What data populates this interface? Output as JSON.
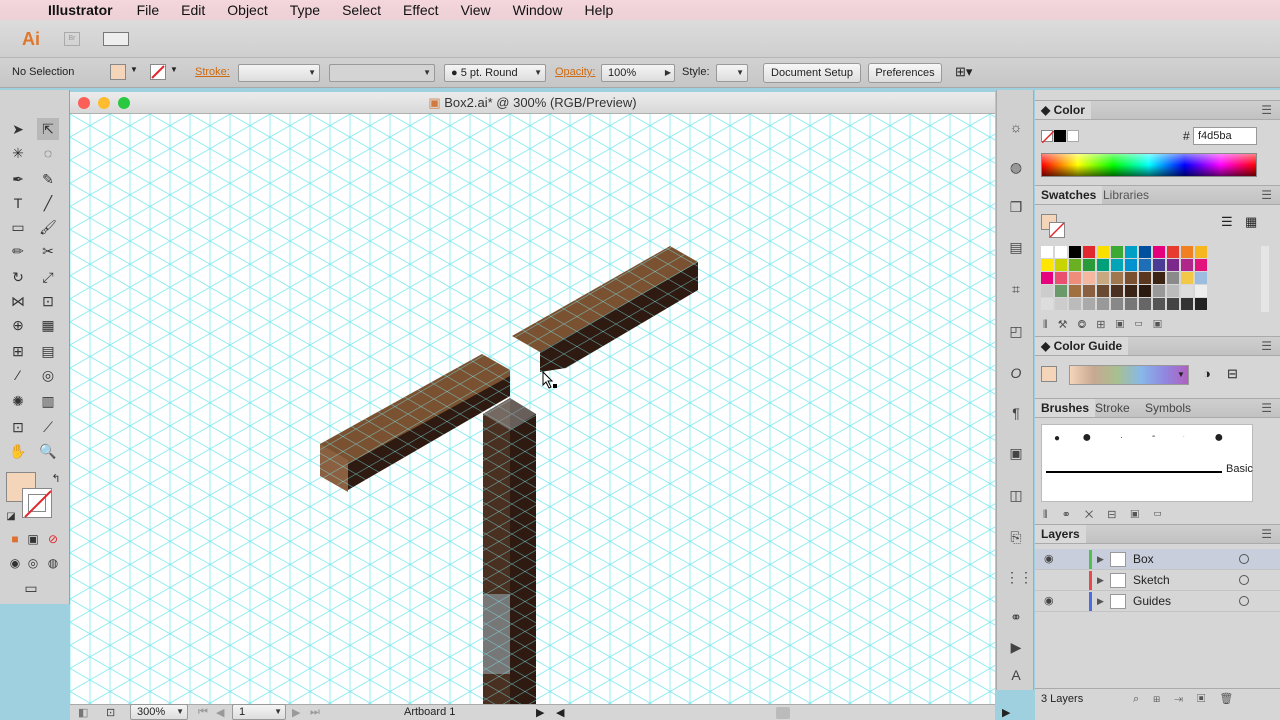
{
  "menubar": {
    "app": "Illustrator",
    "items": [
      "File",
      "Edit",
      "Object",
      "Type",
      "Select",
      "Effect",
      "View",
      "Window",
      "Help"
    ]
  },
  "appbar": {
    "logo": "Ai",
    "bridge": "Br"
  },
  "control": {
    "selection": "No Selection",
    "stroke_label": "Stroke:",
    "brush": "5 pt. Round",
    "opacity_label": "Opacity:",
    "opacity_value": "100%",
    "style_label": "Style:",
    "document_setup": "Document Setup",
    "preferences": "Preferences"
  },
  "document": {
    "title": "Box2.ai* @ 300% (RGB/Preview)",
    "zoom": "300%",
    "artboard_number": "1",
    "artboard_name": "Artboard 1"
  },
  "color_panel": {
    "title": "Color",
    "hex_symbol": "#",
    "hex": "f4d5ba"
  },
  "swatches_panel": {
    "tabs": [
      "Swatches",
      "Libraries"
    ]
  },
  "color_guide_panel": {
    "title": "Color Guide"
  },
  "brushes_panel": {
    "tabs": [
      "Brushes",
      "Stroke",
      "Symbols"
    ],
    "basic_label": "Basic"
  },
  "layers_panel": {
    "title": "Layers",
    "count": "3 Layers",
    "layers": [
      {
        "name": "Box",
        "color": "#4ec24e",
        "visible": true,
        "selected": true
      },
      {
        "name": "Sketch",
        "color": "#e5484d",
        "visible": false,
        "selected": false
      },
      {
        "name": "Guides",
        "color": "#4a6ee0",
        "visible": true,
        "selected": false
      }
    ]
  },
  "colors": {
    "fill": "#f4d5ba",
    "grid": "#76e6ec",
    "box_top": "#7a5232",
    "box_dark": "#2e1a10"
  }
}
